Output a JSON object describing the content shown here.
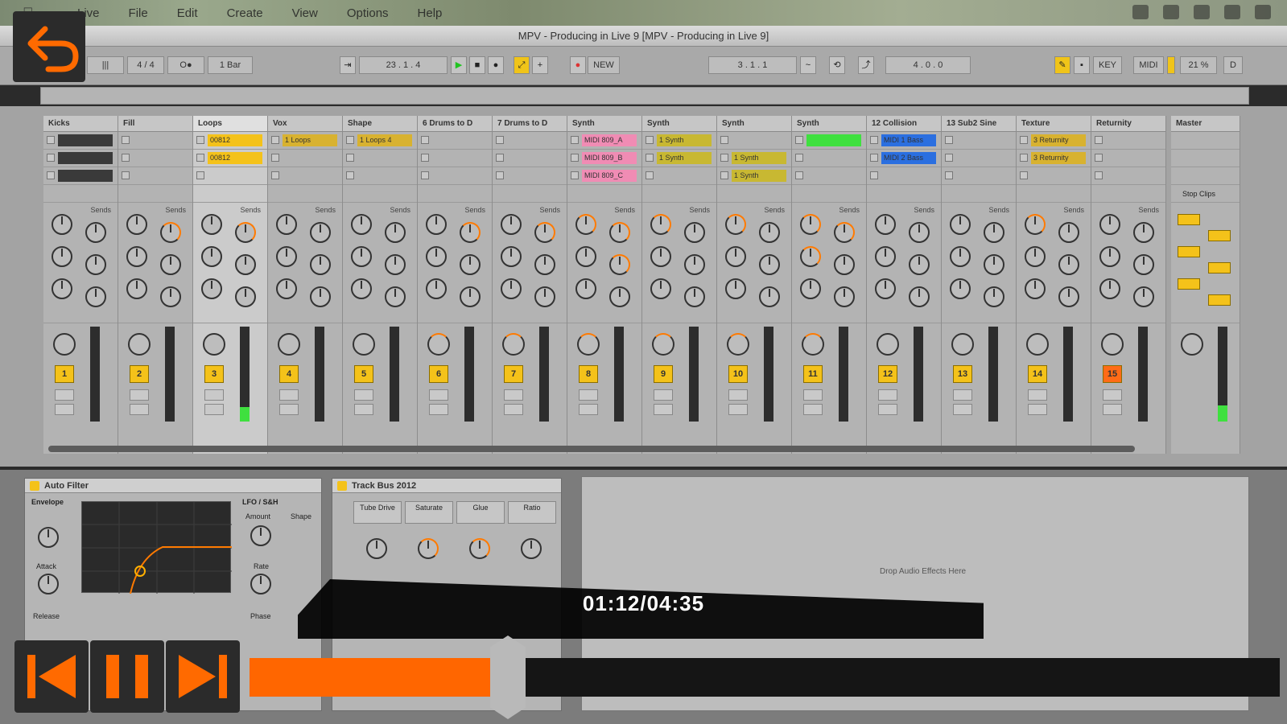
{
  "menubar": {
    "items": [
      "Live",
      "File",
      "Edit",
      "Create",
      "View",
      "Options",
      "Help"
    ]
  },
  "window": {
    "title": "MPV - Producing in Live 9  [MPV - Producing in Live 9]"
  },
  "transport": {
    "signature": "4 / 4",
    "quantize": "1 Bar",
    "position": "23 . 1 . 4",
    "loop_start": "3 . 1 . 1",
    "loop_length": "4 . 0 . 0",
    "new_label": "NEW",
    "key_label": "KEY",
    "midi_label": "MIDI",
    "cpu": "21 %",
    "hd": "D"
  },
  "tracks": [
    {
      "name": "Kicks",
      "number": "1",
      "clips": [
        "",
        "",
        ""
      ],
      "selected": false
    },
    {
      "name": "Fill",
      "number": "2",
      "clips": [],
      "selected": false
    },
    {
      "name": "Loops",
      "number": "3",
      "clips": [
        "00812",
        "00812"
      ],
      "selected": true
    },
    {
      "name": "Vox",
      "number": "4",
      "clips": [
        "1 Loops"
      ],
      "selected": false
    },
    {
      "name": "Shape",
      "number": "5",
      "clips": [
        "1 Loops 4"
      ],
      "selected": false
    },
    {
      "name": "6 Drums to D",
      "number": "6",
      "clips": [],
      "selected": false
    },
    {
      "name": "7 Drums to D",
      "number": "7",
      "clips": [],
      "selected": false
    },
    {
      "name": "Synth",
      "number": "8",
      "clips": [
        "MIDI 809_A",
        "MIDI 809_B",
        "MIDI 809_C"
      ],
      "selected": false
    },
    {
      "name": "Synth",
      "number": "9",
      "clips": [
        "1 Synth",
        "1 Synth"
      ],
      "selected": false
    },
    {
      "name": "Synth",
      "number": "10",
      "clips": [
        "",
        "1 Synth",
        "1 Synth"
      ],
      "selected": false
    },
    {
      "name": "Synth",
      "number": "11",
      "clips": [
        ""
      ],
      "selected": false
    },
    {
      "name": "12 Collision",
      "number": "12",
      "clips": [
        "MIDI 1 Bass",
        "MIDI 2 Bass"
      ],
      "selected": false
    },
    {
      "name": "13 Sub2 Sine",
      "number": "13",
      "clips": [],
      "selected": false
    },
    {
      "name": "Texture",
      "number": "14",
      "clips": [
        "3 Returnity",
        "3 Returnity"
      ],
      "selected": false
    },
    {
      "name": "Returnity",
      "number": "15",
      "clips": [],
      "selected": false
    }
  ],
  "master": {
    "name": "Master",
    "stop_clips": "Stop Clips"
  },
  "sends_label": "Sends",
  "devices": {
    "auto_filter": {
      "title": "Auto Filter",
      "envelope": "Envelope",
      "lfo": "LFO / S&H",
      "amount": "Amount",
      "shape": "Shape",
      "attack": "Attack",
      "release": "Release",
      "rate": "Rate",
      "phase": "Phase"
    },
    "track_bus": {
      "title": "Track Bus 2012",
      "tube_drive": "Tube Drive",
      "saturate": "Saturate",
      "glue": "Glue",
      "ratio": "Ratio"
    },
    "drop_hint": "Drop Audio Effects Here"
  },
  "player": {
    "time": "01:12/04:35",
    "progress": 0.251
  },
  "colors": {
    "accent": "#ff6600",
    "clip_yellow": "#f4c21a",
    "clip_pink": "#f08cb4",
    "clip_green": "#3fe03f",
    "clip_blue": "#2b6fe0",
    "clip_olive": "#c8b832"
  }
}
